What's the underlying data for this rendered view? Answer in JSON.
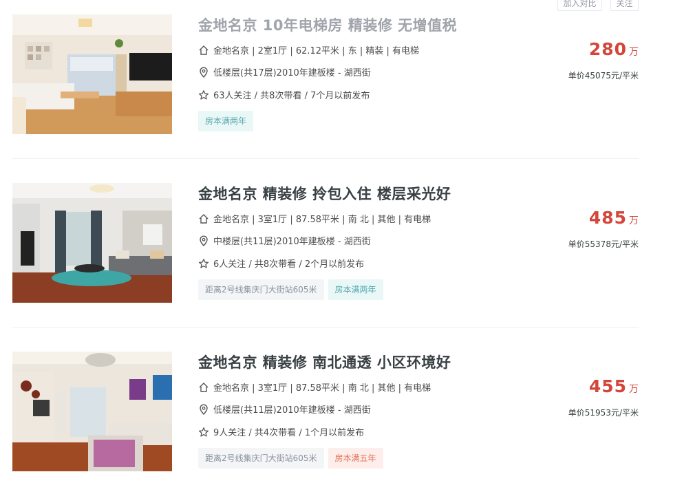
{
  "top_actions": {
    "compare_label": "加入对比",
    "follow_label": "关注"
  },
  "listings": [
    {
      "title": "金地名京 10年电梯房 精装修 无增值税",
      "house_info": "金地名京 | 2室1厅 | 62.12平米 | 东 | 精装 | 有电梯",
      "position_info": "低楼层(共17层)2010年建板楼 - 湖西街",
      "follow_info": "63人关注 / 共8次带看 / 7个月以前发布",
      "tags": [
        {
          "label": "房本满两年",
          "style": "teal"
        }
      ],
      "price": "280",
      "price_unit": "万",
      "unit_price": "单价45075元/平米"
    },
    {
      "title": "金地名京 精装修 拎包入住 楼层采光好",
      "house_info": "金地名京 | 3室1厅 | 87.58平米 | 南 北 | 其他 | 有电梯",
      "position_info": "中楼层(共11层)2010年建板楼 - 湖西街",
      "follow_info": "6人关注 / 共8次带看 / 2个月以前发布",
      "tags": [
        {
          "label": "距离2号线集庆门大街站605米",
          "style": "gray"
        },
        {
          "label": "房本满两年",
          "style": "teal"
        }
      ],
      "price": "485",
      "price_unit": "万",
      "unit_price": "单价55378元/平米"
    },
    {
      "title": "金地名京 精装修 南北通透 小区环境好",
      "house_info": "金地名京 | 3室1厅 | 87.58平米 | 南 北 | 其他 | 有电梯",
      "position_info": "低楼层(共11层)2010年建板楼 - 湖西街",
      "follow_info": "9人关注 / 共4次带看 / 1个月以前发布",
      "tags": [
        {
          "label": "距离2号线集庆门大街站605米",
          "style": "gray"
        },
        {
          "label": "房本满五年",
          "style": "pink"
        }
      ],
      "price": "455",
      "price_unit": "万",
      "unit_price": "单价51953元/平米"
    }
  ],
  "icons": {
    "house": "house-icon",
    "location": "location-pin-icon",
    "star": "star-icon"
  },
  "colors": {
    "price": "#d4453a",
    "tag_teal": "#55a8ae",
    "tag_pink": "#e5735a",
    "title": "#394043"
  }
}
